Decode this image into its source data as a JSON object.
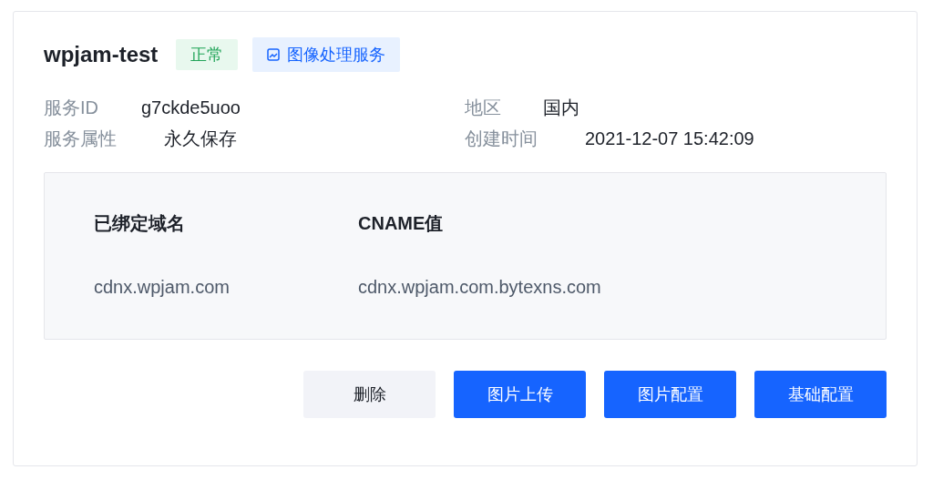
{
  "title": "wpjam-test",
  "status_badge": {
    "label": "正常"
  },
  "service_badge": {
    "label": "图像处理服务"
  },
  "info": [
    {
      "label": "服务ID",
      "value": "g7ckde5uoo"
    },
    {
      "label": "地区",
      "value": "国内"
    },
    {
      "label": "服务属性",
      "value": "永久保存"
    },
    {
      "label": "创建时间",
      "value": "2021-12-07 15:42:09"
    }
  ],
  "domains": {
    "columns": [
      "已绑定域名",
      "CNAME值"
    ],
    "rows": [
      [
        "cdnx.wpjam.com",
        "cdnx.wpjam.com.bytexns.com"
      ]
    ]
  },
  "buttons": [
    {
      "label": "删除",
      "kind": "secondary"
    },
    {
      "label": "图片上传",
      "kind": "primary"
    },
    {
      "label": "图片配置",
      "kind": "primary"
    },
    {
      "label": "基础配置",
      "kind": "primary"
    }
  ]
}
